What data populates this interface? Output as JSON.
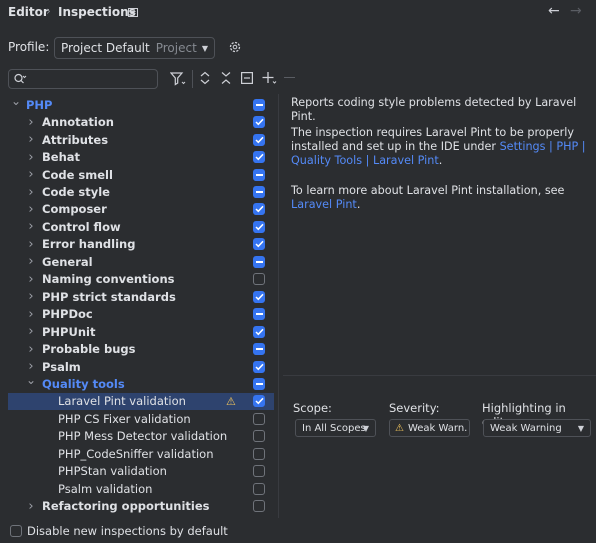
{
  "header": {
    "crumb_root": "Editor",
    "separator": "›",
    "crumb_current": "Inspections",
    "back": "←",
    "forward": "→"
  },
  "profile": {
    "label": "Profile:",
    "value": "Project Default",
    "scope_hint": "Project"
  },
  "search": {
    "placeholder": ""
  },
  "tree": [
    {
      "label": "PHP",
      "level": 0,
      "expanded": true,
      "state": "mixed",
      "style": "accent"
    },
    {
      "label": "Annotation",
      "level": 1,
      "state": "checked",
      "style": "bold"
    },
    {
      "label": "Attributes",
      "level": 1,
      "state": "checked",
      "style": "bold"
    },
    {
      "label": "Behat",
      "level": 1,
      "state": "checked",
      "style": "bold"
    },
    {
      "label": "Code smell",
      "level": 1,
      "state": "mixed",
      "style": "bold"
    },
    {
      "label": "Code style",
      "level": 1,
      "state": "mixed",
      "style": "bold"
    },
    {
      "label": "Composer",
      "level": 1,
      "state": "checked",
      "style": "bold"
    },
    {
      "label": "Control flow",
      "level": 1,
      "state": "checked",
      "style": "bold"
    },
    {
      "label": "Error handling",
      "level": 1,
      "state": "checked",
      "style": "bold"
    },
    {
      "label": "General",
      "level": 1,
      "state": "mixed",
      "style": "bold"
    },
    {
      "label": "Naming conventions",
      "level": 1,
      "state": "unchecked",
      "style": "bold"
    },
    {
      "label": "PHP strict standards",
      "level": 1,
      "state": "checked",
      "style": "bold"
    },
    {
      "label": "PHPDoc",
      "level": 1,
      "state": "mixed",
      "style": "bold"
    },
    {
      "label": "PHPUnit",
      "level": 1,
      "state": "checked",
      "style": "bold"
    },
    {
      "label": "Probable bugs",
      "level": 1,
      "state": "mixed",
      "style": "bold"
    },
    {
      "label": "Psalm",
      "level": 1,
      "state": "checked",
      "style": "bold"
    },
    {
      "label": "Quality tools",
      "level": 1,
      "expanded": true,
      "state": "mixed",
      "style": "accent"
    },
    {
      "label": "Laravel Pint validation",
      "level": 2,
      "state": "checked",
      "style": "normal",
      "selected": true,
      "warning": true
    },
    {
      "label": "PHP CS Fixer validation",
      "level": 2,
      "state": "unchecked",
      "style": "normal"
    },
    {
      "label": "PHP Mess Detector validation",
      "level": 2,
      "state": "unchecked",
      "style": "normal"
    },
    {
      "label": "PHP_CodeSniffer validation",
      "level": 2,
      "state": "unchecked",
      "style": "normal"
    },
    {
      "label": "PHPStan validation",
      "level": 2,
      "state": "unchecked",
      "style": "normal"
    },
    {
      "label": "Psalm validation",
      "level": 2,
      "state": "unchecked",
      "style": "normal"
    },
    {
      "label": "Refactoring opportunities",
      "level": 1,
      "state": "unchecked",
      "style": "bold"
    }
  ],
  "description": {
    "p1": "Reports coding style problems detected by Laravel Pint.",
    "p2_text": "The inspection requires Laravel Pint to be properly installed and set up in the IDE under ",
    "p2_link": "Settings | PHP | Quality Tools | Laravel Pint",
    "p2_end": ".",
    "p3_text": "To learn more about Laravel Pint installation, see ",
    "p3_link": "Laravel Pint",
    "p3_end": "."
  },
  "options": {
    "scope_label": "Scope:",
    "scope_value": "In All Scopes",
    "severity_label": "Severity:",
    "severity_value": "Weak Warn.",
    "highlight_label": "Highlighting in editor:",
    "highlight_value": "Weak Warning"
  },
  "footer": {
    "label": "Disable new inspections by default"
  },
  "colors": {
    "accent": "#548af7",
    "checkbox": "#3574f0",
    "selection": "#2e436e",
    "warning": "#f2c55c"
  }
}
